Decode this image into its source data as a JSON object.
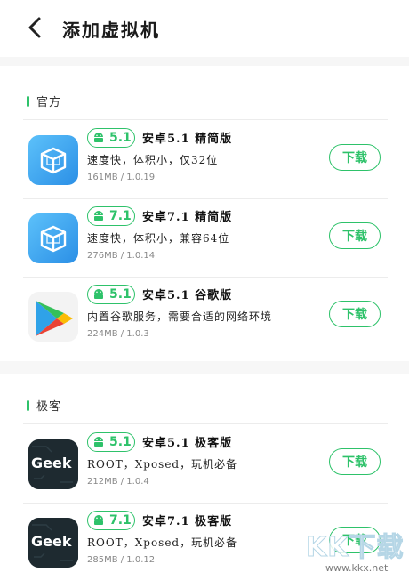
{
  "header": {
    "title": "添加虚拟机"
  },
  "sections": [
    {
      "title": "官方"
    },
    {
      "title": "极客"
    }
  ],
  "apps": [
    {
      "version": "5.1",
      "name": "安卓5.1 精简版",
      "desc": "速度快，体积小，仅32位",
      "meta": "161MB / 1.0.19",
      "button": "下载",
      "icon": "vmos-box-icon"
    },
    {
      "version": "7.1",
      "name": "安卓7.1 精简版",
      "desc": "速度快，体积小，兼容64位",
      "meta": "276MB / 1.0.14",
      "button": "下载",
      "icon": "vmos-box-icon"
    },
    {
      "version": "5.1",
      "name": "安卓5.1 谷歌版",
      "desc": "内置谷歌服务，需要合适的网络环境",
      "meta": "224MB / 1.0.3",
      "button": "下载",
      "icon": "google-play-icon"
    },
    {
      "version": "5.1",
      "name": "安卓5.1 极客版",
      "desc": "ROOT，Xposed，玩机必备",
      "meta": "212MB / 1.0.4",
      "button": "下载",
      "icon": "geek-icon"
    },
    {
      "version": "7.1",
      "name": "安卓7.1 极客版",
      "desc": "ROOT，Xposed，玩机必备",
      "meta": "285MB / 1.0.12",
      "button": "下载",
      "icon": "geek-icon"
    }
  ],
  "geek_label": "Geek",
  "watermark": {
    "logo": "KK下载",
    "url": "www.kkx.net"
  },
  "colors": {
    "accent": "#2ec26a",
    "vmos_blue": "#3aa7f0",
    "geek_bg": "#1e2a30"
  }
}
